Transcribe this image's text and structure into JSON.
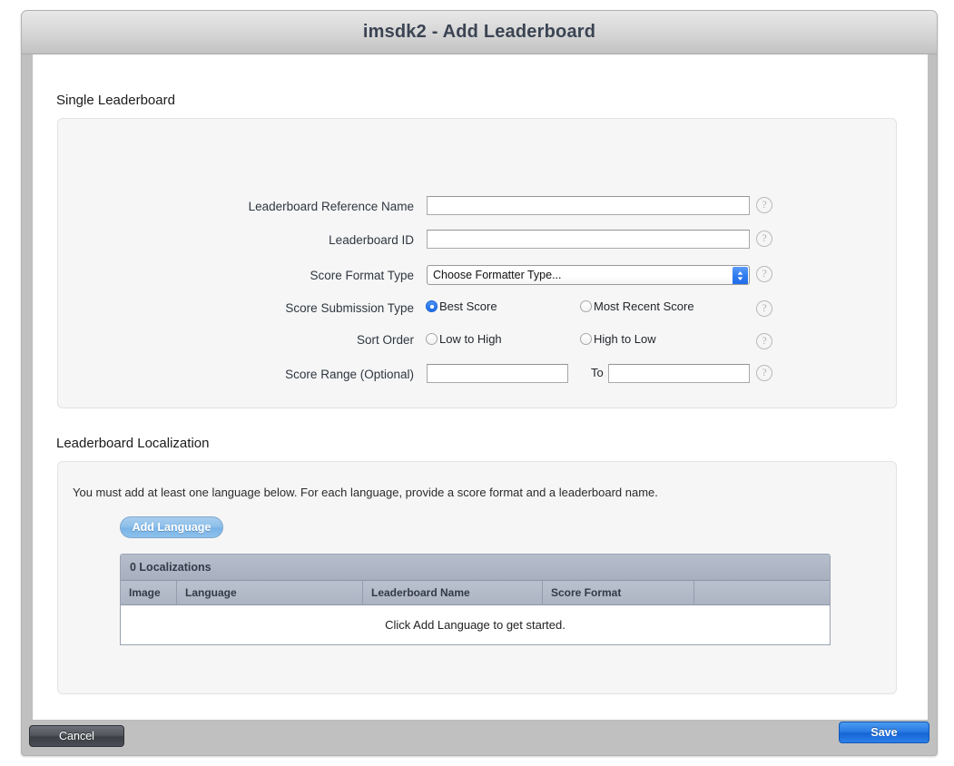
{
  "window": {
    "title": "imsdk2 - Add Leaderboard"
  },
  "single_leaderboard": {
    "heading": "Single Leaderboard",
    "fields": {
      "reference_name_label": "Leaderboard Reference Name",
      "reference_name_value": "",
      "leaderboard_id_label": "Leaderboard ID",
      "leaderboard_id_value": "",
      "score_format_label": "Score Format Type",
      "score_format_value": "Choose Formatter Type...",
      "submission_type_label": "Score Submission Type",
      "submission_option_1": "Best Score",
      "submission_option_2": "Most Recent Score",
      "submission_selected": 1,
      "sort_order_label": "Sort Order",
      "sort_option_1": "Low to High",
      "sort_option_2": "High to Low",
      "sort_selected": 0,
      "score_range_label": "Score Range (Optional)",
      "score_range_from_value": "",
      "score_range_to_label": "To",
      "score_range_to_value": ""
    },
    "help_icon": "question-mark-icon"
  },
  "localization": {
    "heading": "Leaderboard Localization",
    "instructions": "You must add at least one language below. For each language, provide a score format and a leaderboard name.",
    "add_language_label": "Add Language",
    "table": {
      "caption": "0 Localizations",
      "columns": [
        "Image",
        "Language",
        "Leaderboard Name",
        "Score Format",
        ""
      ],
      "rows": [],
      "empty_message": "Click Add Language to get started."
    }
  },
  "footer": {
    "cancel_label": "Cancel",
    "save_label": "Save"
  },
  "colors": {
    "accent_blue": "#2a7ae4",
    "table_header": "#b0b8c6",
    "panel_bg": "#f6f6f6"
  }
}
